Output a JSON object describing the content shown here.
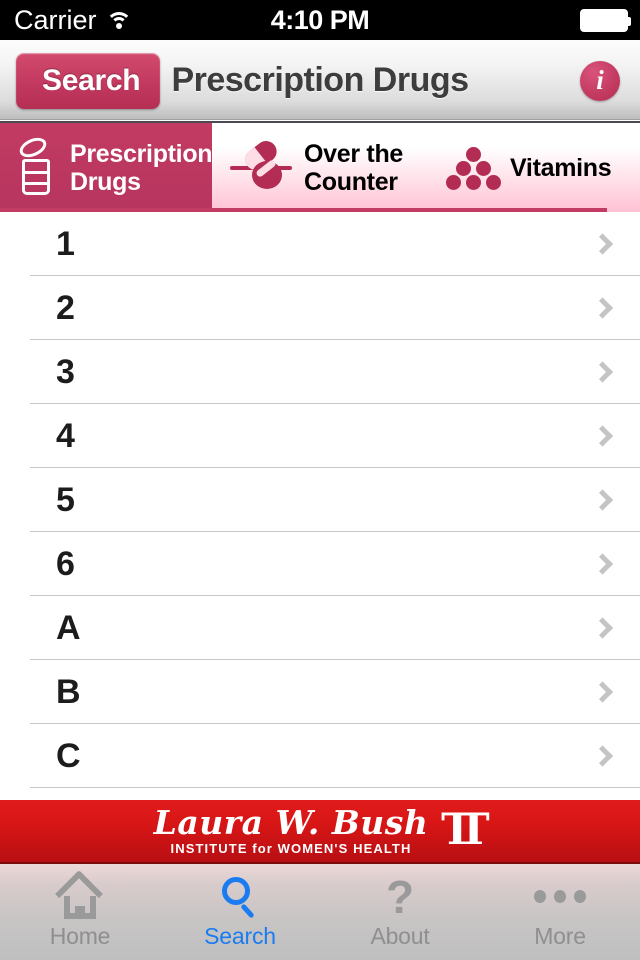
{
  "status_bar": {
    "carrier": "Carrier",
    "time": "4:10 PM",
    "wifi_icon": "wifi-icon",
    "battery_icon": "battery-full-icon"
  },
  "nav_bar": {
    "back_label": "Search",
    "title": "Prescription Drugs",
    "info_label": "i",
    "info_icon": "info-circle-icon"
  },
  "category_tabs": [
    {
      "label_line1": "Prescription",
      "label_line2": "Drugs",
      "icon": "pill-bottle-icon",
      "active": true
    },
    {
      "label_line1": "Over the",
      "label_line2": "Counter",
      "icon": "capsules-icon",
      "active": false
    },
    {
      "label_line1": "Vitamins",
      "label_line2": "",
      "icon": "vitamin-dots-icon",
      "active": false
    }
  ],
  "list": {
    "rows": [
      {
        "label": "1"
      },
      {
        "label": "2"
      },
      {
        "label": "3"
      },
      {
        "label": "4"
      },
      {
        "label": "5"
      },
      {
        "label": "6"
      },
      {
        "label": "A"
      },
      {
        "label": "B"
      },
      {
        "label": "C"
      }
    ]
  },
  "banner": {
    "script_text": "Laura W. Bush",
    "subtitle": "INSTITUTE for WOMEN'S HEALTH",
    "logo": "texas-tech-double-t-logo",
    "logo_text": "TT"
  },
  "tab_bar": {
    "items": [
      {
        "label": "Home",
        "icon": "home-icon",
        "active": false
      },
      {
        "label": "Search",
        "icon": "search-icon",
        "active": true
      },
      {
        "label": "About",
        "icon": "question-icon",
        "active": false
      },
      {
        "label": "More",
        "icon": "ellipsis-icon",
        "active": false
      }
    ]
  },
  "colors": {
    "accent_crimson": "#c23b62",
    "banner_red": "#d91616",
    "active_blue": "#1a7cf0",
    "inactive_gray": "#9a9a9a"
  }
}
